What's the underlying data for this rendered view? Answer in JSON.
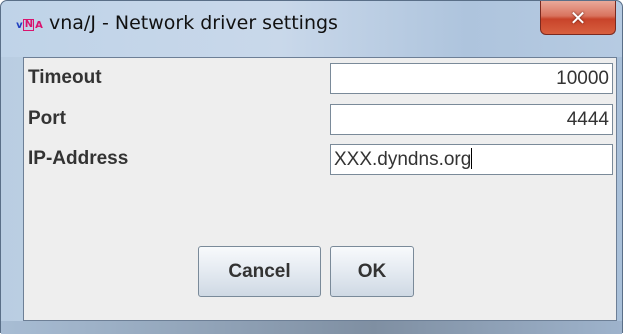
{
  "window": {
    "title": "vna/J - Network driver settings",
    "icon": "vnaj-app-icon",
    "close_symbol": "✕"
  },
  "fields": [
    {
      "label": "Timeout",
      "value": "10000"
    },
    {
      "label": "Port",
      "value": "4444"
    },
    {
      "label": "IP-Address",
      "value": "XXX.dyndns.org"
    }
  ],
  "buttons": {
    "cancel": "Cancel",
    "ok": "OK"
  },
  "colors": {
    "close_button": "#c8432a",
    "dialog_background": "#eeeeee",
    "titlebar": "#c3d4e6"
  }
}
